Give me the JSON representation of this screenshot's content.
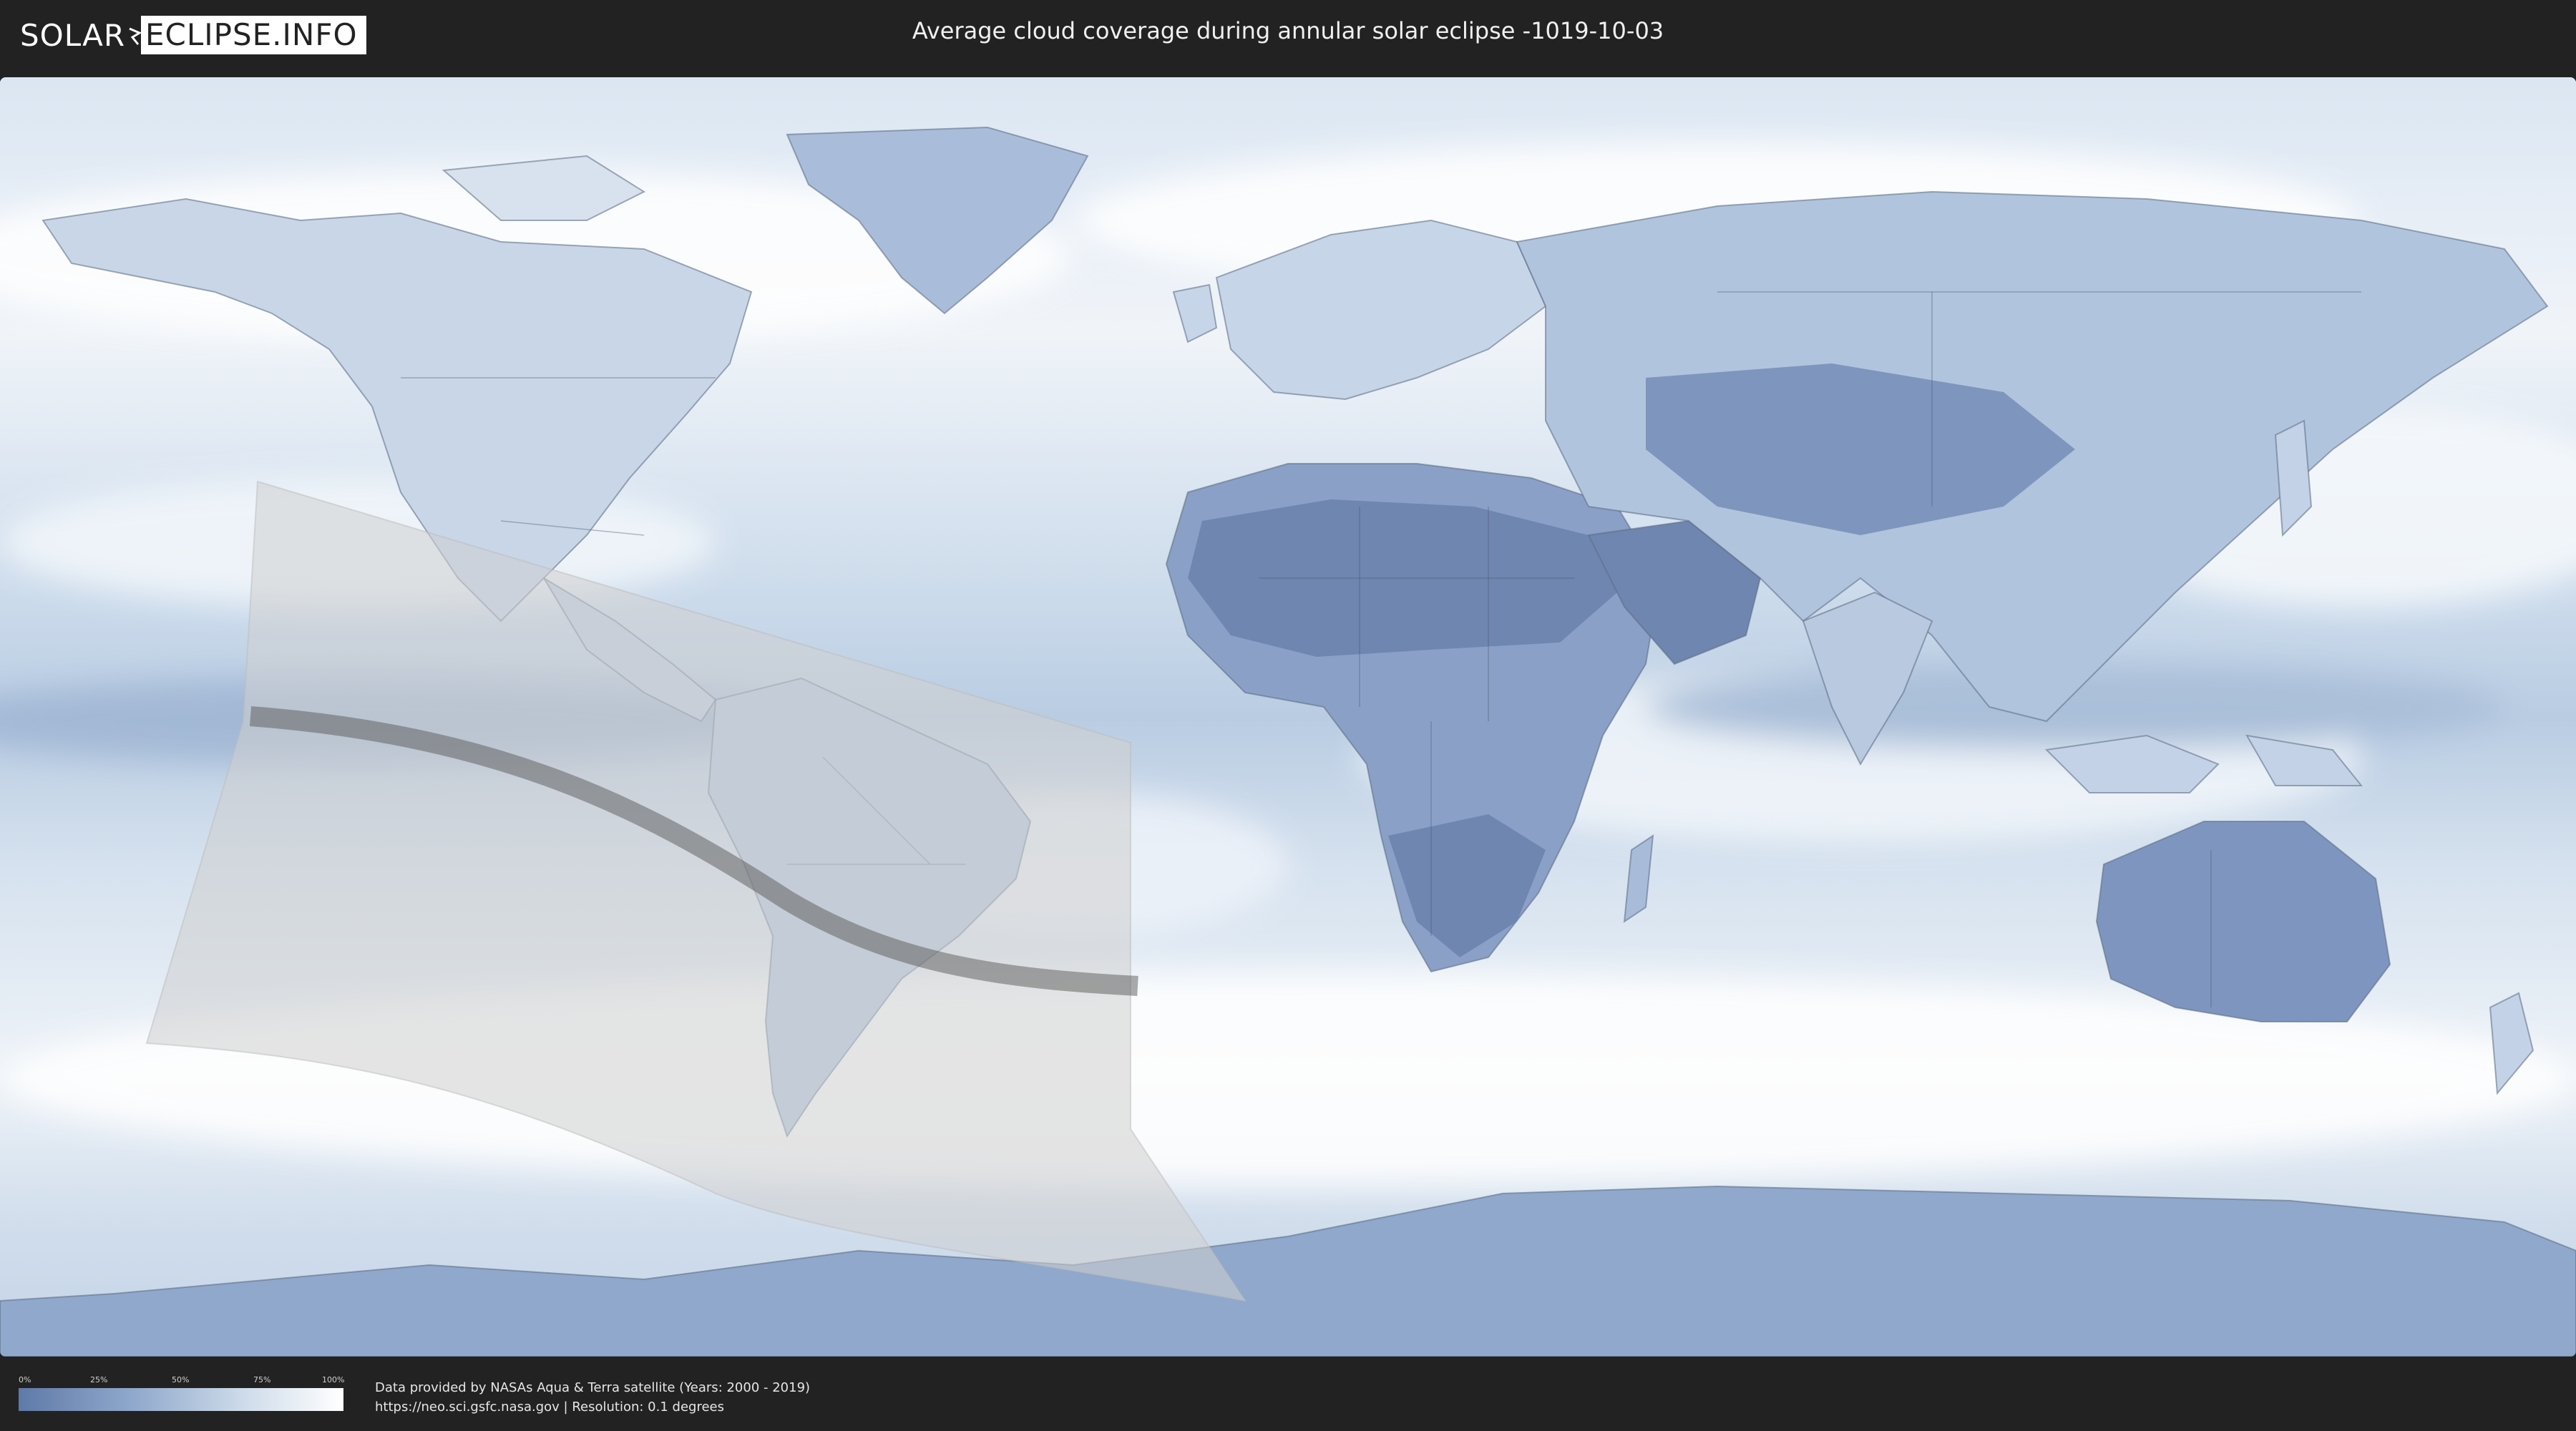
{
  "header": {
    "logo_left": "SOLAR",
    "logo_right": "ECLIPSE.INFO",
    "title": "Average cloud coverage during annular solar eclipse -1019-10-03"
  },
  "map": {
    "type": "world cloud coverage map",
    "eclipse_type": "annular",
    "date": "-1019-10-03",
    "colors": {
      "ocean_clear": "#c8d8ea",
      "cloudy": "#f4f7fb",
      "dry_land": "#6f86b0",
      "eclipse_overlay": "#cfcfcf",
      "central_path": "#5a5a5a",
      "borders": "#4a5a72"
    }
  },
  "legend": {
    "ticks": [
      "0%",
      "25%",
      "50%",
      "75%",
      "100%"
    ],
    "gradient_start": "#5f7aa8",
    "gradient_end": "#ffffff"
  },
  "footer": {
    "credit_line1": "Data provided by NASAs Aqua & Terra satellite (Years: 2000 - 2019)",
    "credit_line2": "https://neo.sci.gsfc.nasa.gov | Resolution: 0.1 degrees"
  }
}
